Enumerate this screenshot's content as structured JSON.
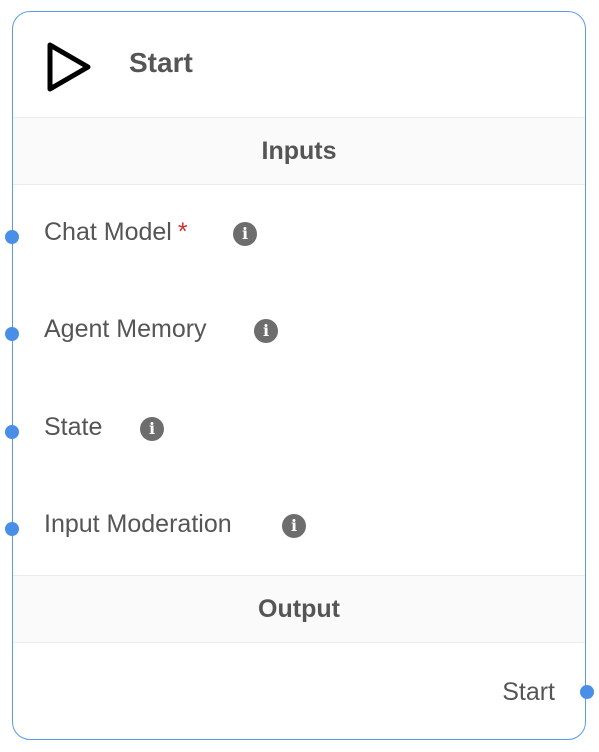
{
  "node": {
    "title": "Start",
    "icon": "play-icon",
    "inputs_heading": "Inputs",
    "output_heading": "Output",
    "inputs": [
      {
        "label": "Chat Model",
        "required": "*"
      },
      {
        "label": "Agent Memory"
      },
      {
        "label": "State"
      },
      {
        "label": "Input Moderation"
      }
    ],
    "info_glyph": "i",
    "output_label": "Start"
  },
  "colors": {
    "border": "#5b9be6",
    "handle": "#4a8fe7",
    "required": "#d32f2f",
    "text": "#555555"
  }
}
